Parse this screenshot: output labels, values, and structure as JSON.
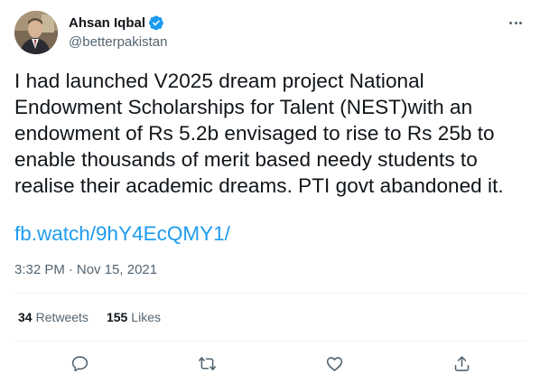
{
  "author": {
    "display_name": "Ahsan Iqbal",
    "handle": "@betterpakistan",
    "verified": true
  },
  "tweet": {
    "text": "I had launched V2025 dream project National\nEndowment Scholarships for Talent (NEST)with an\nendowment of Rs 5.2b envisaged to rise to Rs 25b to\nenable thousands of merit based needy students to\nrealise their academic dreams. PTI govt abandoned it.",
    "link": "fb.watch/9hY4EcQMY1/",
    "time": "3:32 PM",
    "separator": "·",
    "date": "Nov 15, 2021"
  },
  "stats": {
    "retweets_count": "34",
    "retweets_label": "Retweets",
    "likes_count": "155",
    "likes_label": "Likes"
  },
  "colors": {
    "accent": "#1d9bf0",
    "text_primary": "#0f1419",
    "text_secondary": "#536471",
    "divider": "#eff3f4"
  },
  "icons": [
    "verified-badge-icon",
    "more-icon",
    "reply-icon",
    "retweet-icon",
    "like-icon",
    "share-icon"
  ]
}
